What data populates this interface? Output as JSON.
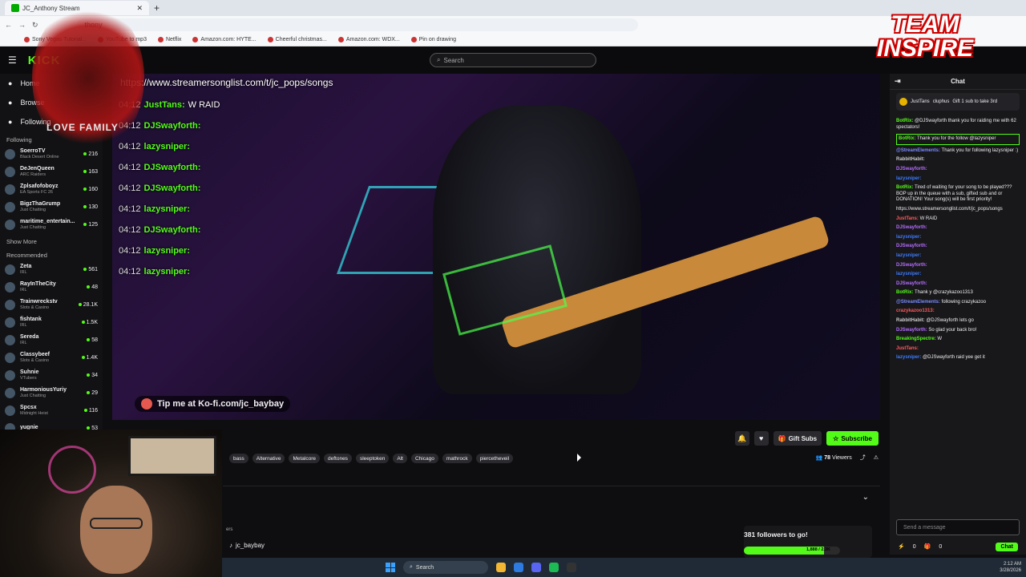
{
  "browser": {
    "tab_title": "JC_Anthony Stream",
    "address_suffix": "thony",
    "bookmarks": [
      "Sony Vegas Tutorial...",
      "YouTube to mp3",
      "Netflix",
      "Amazon.com: HYTE...",
      "Cheerful christmas...",
      "Amazon.com: WDX...",
      "Pin on drawing"
    ]
  },
  "header": {
    "logo": "KICK",
    "search_placeholder": "Search"
  },
  "sidebar": {
    "nav": [
      {
        "label": "Home",
        "icon": "home-icon"
      },
      {
        "label": "Browse",
        "icon": "browse-icon"
      },
      {
        "label": "Following",
        "icon": "heart-icon"
      }
    ],
    "following_title": "Following",
    "following": [
      {
        "name": "SoerroTV",
        "game": "Black Desert Online",
        "viewers": "216"
      },
      {
        "name": "DeJenQueen",
        "game": "ARC Raiders",
        "viewers": "163"
      },
      {
        "name": "Zplsafofoboyz",
        "game": "EA Sports FC 26",
        "viewers": "160"
      },
      {
        "name": "BigzThaGrump",
        "game": "Just Chatting",
        "viewers": "130"
      },
      {
        "name": "maritime_entertain...",
        "game": "Just Chatting",
        "viewers": "125"
      }
    ],
    "show_more": "Show More",
    "recommended_title": "Recommended",
    "recommended": [
      {
        "name": "Zeta",
        "game": "IRL",
        "viewers": "561"
      },
      {
        "name": "RayInTheCity",
        "game": "IRL",
        "viewers": "48"
      },
      {
        "name": "Trainwreckstv",
        "game": "Slots & Casino",
        "viewers": "28.1K"
      },
      {
        "name": "fishtank",
        "game": "IRL",
        "viewers": "1.5K"
      },
      {
        "name": "Sereda",
        "game": "IRL",
        "viewers": "58"
      },
      {
        "name": "Classybeef",
        "game": "Slots & Casino",
        "viewers": "1.4K"
      },
      {
        "name": "Suhnie",
        "game": "VTubers",
        "viewers": "34"
      },
      {
        "name": "HarmoniousYuriy",
        "game": "Just Chatting",
        "viewers": "29"
      },
      {
        "name": "Spcsx",
        "game": "Midnight Heist",
        "viewers": "116"
      },
      {
        "name": "yugnie",
        "game": "",
        "viewers": "53"
      }
    ]
  },
  "player": {
    "overlay_url": "https://www.streamersonglist.com/t/jc_pops/songs",
    "overlay_chat": [
      {
        "time": "04:12",
        "user": "JustTans:",
        "text": "W RAID"
      },
      {
        "time": "04:12",
        "user": "DJSwayforth:",
        "text": ""
      },
      {
        "time": "04:12",
        "user": "lazysniper:",
        "text": ""
      },
      {
        "time": "04:12",
        "user": "DJSwayforth:",
        "text": ""
      },
      {
        "time": "04:12",
        "user": "DJSwayforth:",
        "text": ""
      },
      {
        "time": "04:12",
        "user": "lazysniper:",
        "text": ""
      },
      {
        "time": "04:12",
        "user": "DJSwayforth:",
        "text": ""
      },
      {
        "time": "04:12",
        "user": "lazysniper:",
        "text": ""
      },
      {
        "time": "04:12",
        "user": "lazysniper:",
        "text": ""
      }
    ],
    "tip_text": "Tip me at Ko-fi.com/jc_baybay",
    "sticker_text": "LOVE FAMILY",
    "team_logo": [
      "TEAM",
      "INSPIRE"
    ]
  },
  "stream_info": {
    "gift_label": "Gift Subs",
    "subscribe_label": "Subscribe",
    "tags": [
      "bass",
      "Alternative",
      "Metalcore",
      "deftones",
      "sleeptoken",
      "Alt",
      "Chicago",
      "mathrock",
      "piercetheveil"
    ],
    "viewers": "78",
    "viewers_label": "Viewers",
    "about_label": "ers",
    "streamer": "jc_baybay",
    "goal_title": "381 followers to go!",
    "goal_value": "1,888 / 2.3K",
    "goal_progress": 0.83
  },
  "chat": {
    "title": "Chat",
    "pinned": [
      {
        "user": "JustTans",
        "text": ""
      },
      {
        "user": "cluphus",
        "text": "Gift 1 sub to take 3rd"
      }
    ],
    "messages": [
      {
        "user": "BotRix:",
        "text": "@DJSwayforth thank you for raiding me with 62 spectators!",
        "color": "#53fc18"
      },
      {
        "user": "BotRix:",
        "text": "Thank you for the follow @lazysniper",
        "color": "#53fc18",
        "hl": true
      },
      {
        "user": "@StreamElements:",
        "text": "Thank you for following lazysniper :)",
        "color": "#7b8cff"
      },
      {
        "user": "RabbitHabit:",
        "text": "",
        "color": "#ccc"
      },
      {
        "user": "DJSwayforth:",
        "text": "",
        "color": "#b56cff"
      },
      {
        "user": "lazysniper:",
        "text": "",
        "color": "#3d7bff"
      },
      {
        "user": "BotRix:",
        "text": "Tired of waiting for your song to be played??? BOP up in the queue with a sub, gifted sub and or DONATION! Your song(s) will be first priority!",
        "color": "#53fc18"
      },
      {
        "user": "",
        "text": "https://www.streamersonglist.com/t/jc_pops/songs",
        "color": "#fff"
      },
      {
        "user": "JustTans:",
        "text": "W RAID",
        "color": "#ff5a5a"
      },
      {
        "user": "DJSwayforth:",
        "text": "",
        "color": "#b56cff"
      },
      {
        "user": "lazysniper:",
        "text": "",
        "color": "#3d7bff"
      },
      {
        "user": "DJSwayforth:",
        "text": "",
        "color": "#b56cff"
      },
      {
        "user": "lazysniper:",
        "text": "",
        "color": "#3d7bff"
      },
      {
        "user": "DJSwayforth:",
        "text": "",
        "color": "#b56cff"
      },
      {
        "user": "lazysniper:",
        "text": "",
        "color": "#3d7bff"
      },
      {
        "user": "DJSwayforth:",
        "text": "",
        "color": "#b56cff"
      },
      {
        "user": "BotRix:",
        "text": "Thank y @crazykazoo1313",
        "color": "#53fc18"
      },
      {
        "user": "@StreamElements:",
        "text": "following crazykazoo",
        "color": "#7b8cff"
      },
      {
        "user": "crazykazoo1313:",
        "text": "",
        "color": "#ff5a5a"
      },
      {
        "user": "RabbitHabit:",
        "text": "@DJSwayforth lets go",
        "color": "#ccc"
      },
      {
        "user": "DJSwayforth:",
        "text": "So glad your back bro!",
        "color": "#b56cff"
      },
      {
        "user": "BreakingSpectre:",
        "text": "W",
        "color": "#53fc18"
      },
      {
        "user": "JustTans:",
        "text": "",
        "color": "#ff5a5a"
      },
      {
        "user": "lazysniper:",
        "text": "@DJSwayforth raid yee get it",
        "color": "#3d7bff"
      }
    ],
    "input_placeholder": "Send a message",
    "points": "0",
    "send_label": "Chat"
  },
  "taskbar": {
    "search": "Search",
    "time": "2:12 AM",
    "date": "3/28/2026"
  }
}
